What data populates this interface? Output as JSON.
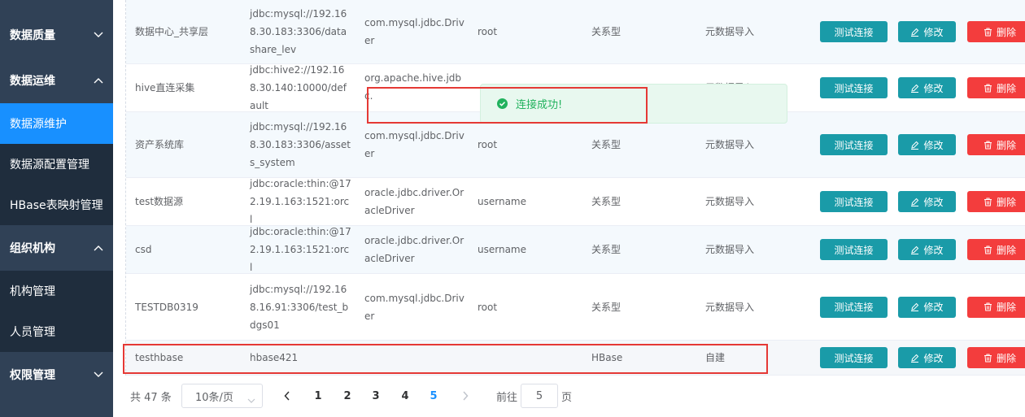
{
  "sidebar": {
    "items": [
      {
        "label": "数据质量",
        "chevron": "down"
      },
      {
        "label": "数据运维",
        "chevron": "up"
      },
      {
        "label": "数据源维护",
        "active": true
      },
      {
        "label": "数据源配置管理"
      },
      {
        "label": "HBase表映射管理"
      },
      {
        "label": "组织机构",
        "chevron": "up"
      },
      {
        "label": "机构管理"
      },
      {
        "label": "人员管理"
      },
      {
        "label": "权限管理",
        "chevron": "down"
      }
    ]
  },
  "table": {
    "actions": {
      "test": "测试连接",
      "edit": "修改",
      "delete": "删除"
    },
    "rows": [
      {
        "name": "数据中心_共享层",
        "url": "jdbc:mysql://192.168.30.183:3306/datashare_lev",
        "driver": "com.mysql.jdbc.Driver",
        "user": "root",
        "type": "关系型",
        "source": "元数据导入"
      },
      {
        "name": "hive直连采集",
        "url": "jdbc:hive2://192.168.30.140:10000/default",
        "driver": "org.apache.hive.jdbc.",
        "user": "",
        "type": "",
        "source": "元数据导入"
      },
      {
        "name": "资产系统库",
        "url": "jdbc:mysql://192.168.30.183:3306/assets_system",
        "driver": "com.mysql.jdbc.Driver",
        "user": "root",
        "type": "关系型",
        "source": "元数据导入"
      },
      {
        "name": "test数据源",
        "url": "jdbc:oracle:thin:@172.19.1.163:1521:orcl",
        "driver": "oracle.jdbc.driver.OracleDriver",
        "user": "username",
        "type": "关系型",
        "source": "元数据导入"
      },
      {
        "name": "csd",
        "url": "jdbc:oracle:thin:@172.19.1.163:1521:orcl",
        "driver": "oracle.jdbc.driver.OracleDriver",
        "user": "username",
        "type": "关系型",
        "source": "元数据导入"
      },
      {
        "name": "TESTDB0319",
        "url": "jdbc:mysql://192.168.16.91:3306/test_bdgs01",
        "driver": "com.mysql.jdbc.Driver",
        "user": "root",
        "type": "关系型",
        "source": "元数据导入"
      },
      {
        "name": "testhbase",
        "url": "hbase421",
        "driver": "",
        "user": "",
        "type": "HBase",
        "source": "自建"
      }
    ]
  },
  "pagination": {
    "total": "共 47 条",
    "page_size": "10条/页",
    "pages": [
      "1",
      "2",
      "3",
      "4",
      "5"
    ],
    "current_page": "5",
    "goto_label": "前往",
    "goto_value": "5",
    "goto_unit": "页"
  },
  "toast": {
    "message": "连接成功!",
    "icon": "check-circle-icon"
  },
  "colors": {
    "sidebar_bg": "#304156",
    "active": "#1890ff",
    "primary_btn": "#1a9ba8",
    "danger_btn": "#f33d3d",
    "success": "#22b25e",
    "highlight_box": "#e53935"
  }
}
